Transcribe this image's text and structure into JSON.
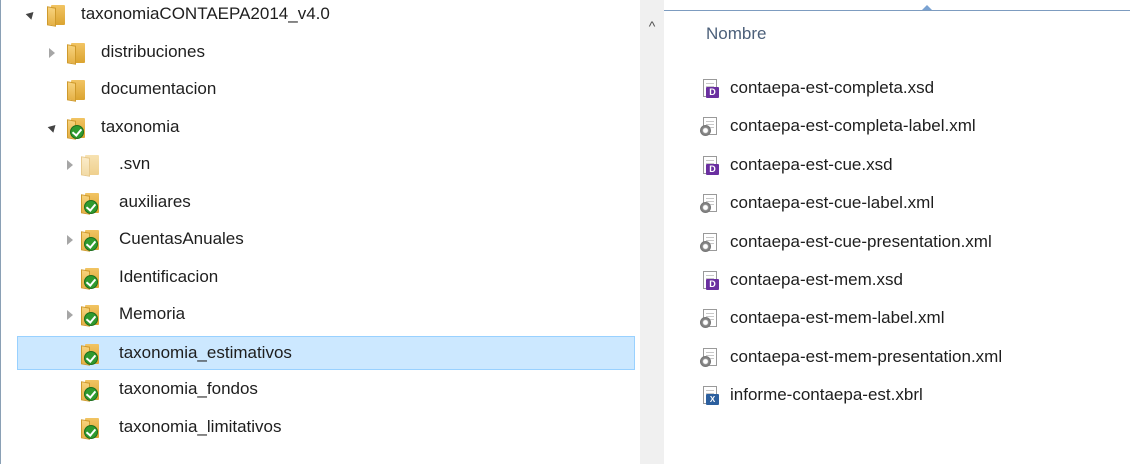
{
  "tree": {
    "items": [
      {
        "label": "taxonomiaCONTAEPA2014_v4.0",
        "expander": "expanded",
        "folder": "plain",
        "indent": 0
      },
      {
        "label": "distribuciones",
        "expander": "collapsed",
        "folder": "plain",
        "indent": 1
      },
      {
        "label": "documentacion",
        "expander": "none",
        "folder": "plain",
        "indent": 1
      },
      {
        "label": "taxonomia",
        "expander": "expanded",
        "folder": "check",
        "indent": 1
      },
      {
        "label": ".svn",
        "expander": "collapsed",
        "folder": "faded",
        "indent": 2
      },
      {
        "label": "auxiliares",
        "expander": "none",
        "folder": "check",
        "indent": 2
      },
      {
        "label": "CuentasAnuales",
        "expander": "collapsed",
        "folder": "check",
        "indent": 2
      },
      {
        "label": "Identificacion",
        "expander": "none",
        "folder": "check",
        "indent": 2
      },
      {
        "label": "Memoria",
        "expander": "collapsed",
        "folder": "check",
        "indent": 2
      },
      {
        "label": "taxonomia_estimativos",
        "expander": "none",
        "folder": "check",
        "indent": 2,
        "selected": true
      },
      {
        "label": "taxonomia_fondos",
        "expander": "none",
        "folder": "check",
        "indent": 2
      },
      {
        "label": "taxonomia_limitativos",
        "expander": "none",
        "folder": "check",
        "indent": 2
      }
    ]
  },
  "scrollbar": {
    "up_arrow": "^"
  },
  "files": {
    "column_header": "Nombre",
    "items": [
      {
        "name": "contaepa-est-completa.xsd",
        "icon": "xsd-file-icon"
      },
      {
        "name": "contaepa-est-completa-label.xml",
        "icon": "xml-file-icon"
      },
      {
        "name": "contaepa-est-cue.xsd",
        "icon": "xsd-file-icon"
      },
      {
        "name": "contaepa-est-cue-label.xml",
        "icon": "xml-file-icon"
      },
      {
        "name": "contaepa-est-cue-presentation.xml",
        "icon": "xml-file-icon"
      },
      {
        "name": "contaepa-est-mem.xsd",
        "icon": "xsd-file-icon"
      },
      {
        "name": "contaepa-est-mem-label.xml",
        "icon": "xml-file-icon"
      },
      {
        "name": "contaepa-est-mem-presentation.xml",
        "icon": "xml-file-icon"
      },
      {
        "name": "informe-contaepa-est.xbrl",
        "icon": "xbrl-file-icon"
      }
    ]
  },
  "colors": {
    "selection": "#cce8ff",
    "selection_border": "#99d1ff",
    "header_text": "#4c607a"
  }
}
